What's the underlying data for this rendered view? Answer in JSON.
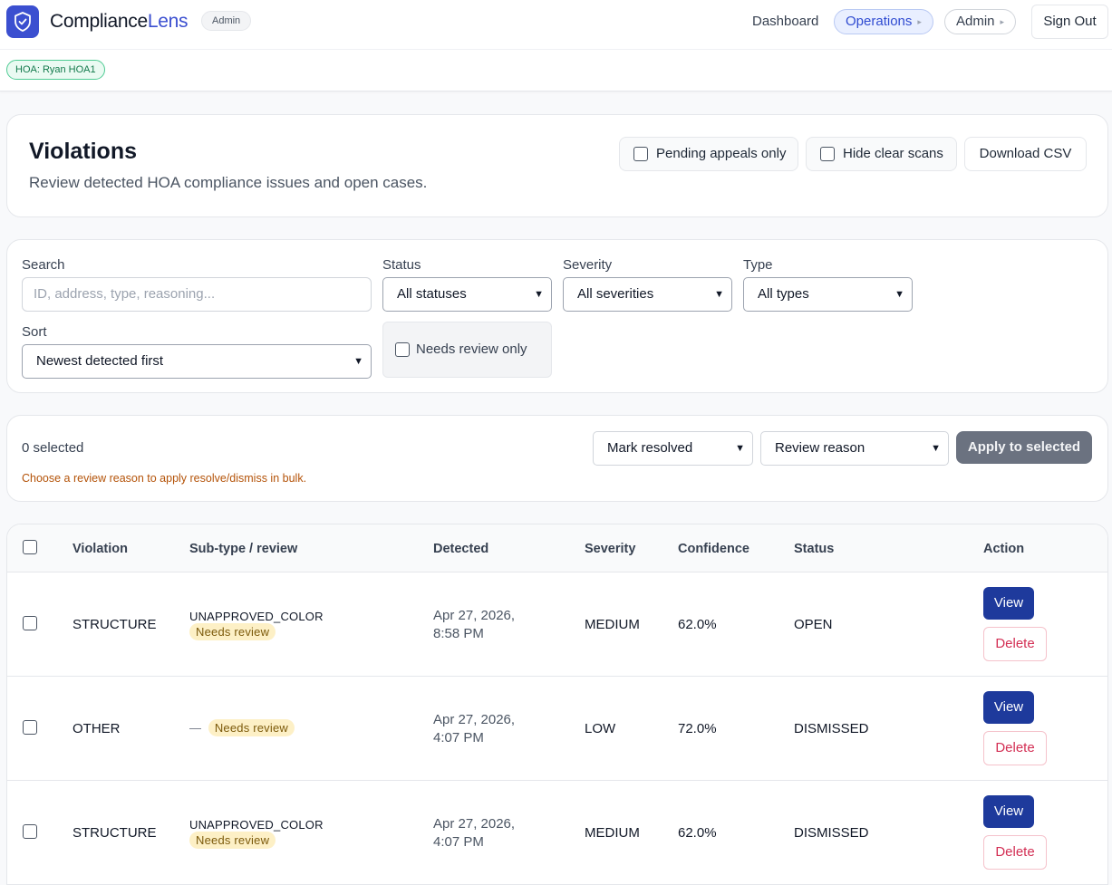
{
  "brand": {
    "name_part1": "Compliance",
    "name_part2": "Lens",
    "role_badge": "Admin",
    "logo_icon": "shield-icon"
  },
  "nav": {
    "dashboard": "Dashboard",
    "operations": "Operations",
    "admin": "Admin",
    "sign_out": "Sign Out"
  },
  "context": {
    "hoa_badge": "HOA: Ryan HOA1"
  },
  "header": {
    "title": "Violations",
    "subtitle": "Review detected HOA compliance issues and open cases.",
    "pending_appeals_label": "Pending appeals only",
    "hide_clear_scans_label": "Hide clear scans",
    "download_csv_label": "Download CSV"
  },
  "filters": {
    "search_label": "Search",
    "search_placeholder": "ID, address, type, reasoning...",
    "status_label": "Status",
    "status_value": "All statuses",
    "severity_label": "Severity",
    "severity_value": "All severities",
    "type_label": "Type",
    "type_value": "All types",
    "sort_label": "Sort",
    "sort_value": "Newest detected first",
    "needs_review_label": "Needs review only"
  },
  "bulk": {
    "selected_count": "0 selected",
    "action_value": "Mark resolved",
    "reason_value": "Review reason",
    "apply_label": "Apply to selected",
    "hint": "Choose a review reason to apply resolve/dismiss in bulk."
  },
  "table": {
    "columns": {
      "violation": "Violation",
      "subtype": "Sub-type / review",
      "detected": "Detected",
      "severity": "Severity",
      "confidence": "Confidence",
      "status": "Status",
      "action": "Action"
    },
    "rows": [
      {
        "violation": "STRUCTURE",
        "subtype": "UNAPPROVED_COLOR",
        "review": "Needs review",
        "detected_date": "Apr 27, 2026,",
        "detected_time": "8:58 PM",
        "severity": "MEDIUM",
        "confidence": "62.0%",
        "status": "OPEN",
        "view": "View",
        "delete": "Delete"
      },
      {
        "violation": "OTHER",
        "subtype": "—",
        "review": "Needs review",
        "detected_date": "Apr 27, 2026,",
        "detected_time": "4:07 PM",
        "severity": "LOW",
        "confidence": "72.0%",
        "status": "DISMISSED",
        "view": "View",
        "delete": "Delete"
      },
      {
        "violation": "STRUCTURE",
        "subtype": "UNAPPROVED_COLOR",
        "review": "Needs review",
        "detected_date": "Apr 27, 2026,",
        "detected_time": "4:07 PM",
        "severity": "MEDIUM",
        "confidence": "62.0%",
        "status": "DISMISSED",
        "view": "View",
        "delete": "Delete"
      }
    ]
  },
  "colors": {
    "brand": "#3b4fd0",
    "view_button": "#1e3a9c",
    "delete_text": "#d32f54",
    "review_pill": "#fdf0c6",
    "hoa_badge": "#4ecb93"
  }
}
